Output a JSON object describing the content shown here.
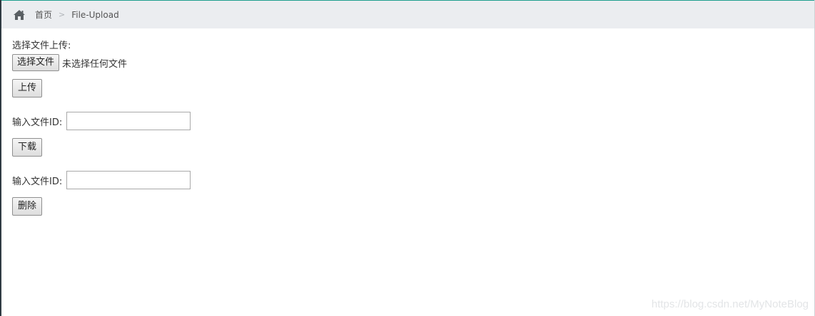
{
  "breadcrumb": {
    "home_icon": "home-icon",
    "home_label": "首页",
    "separator": ">",
    "current": "File-Upload"
  },
  "upload": {
    "label": "选择文件上传:",
    "choose_button": "选择文件",
    "file_status": "未选择任何文件",
    "submit_button": "上传"
  },
  "download": {
    "label": "输入文件ID:",
    "input_value": "",
    "button": "下载"
  },
  "delete": {
    "label": "输入文件ID:",
    "input_value": "",
    "button": "删除"
  },
  "watermark": "https://blog.csdn.net/MyNoteBlog",
  "colors": {
    "accent_line": "#1e9e8e",
    "breadcrumb_bg": "#ebedf0",
    "left_border": "#2f3a42"
  }
}
